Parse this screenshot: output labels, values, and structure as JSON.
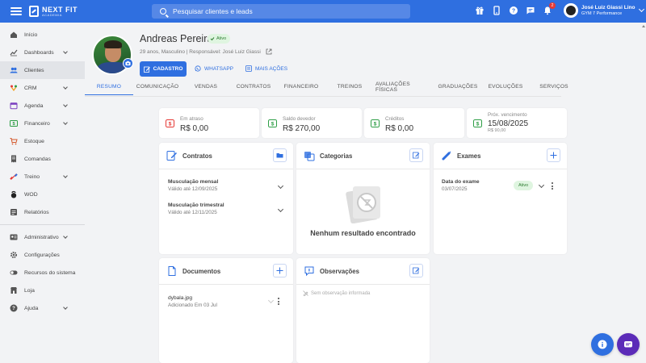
{
  "topbar": {
    "logo_line1": "NEXT FIT",
    "logo_line2": "ACADEMIA",
    "search_placeholder": "Pesquisar clientes e leads",
    "notification_count": "2",
    "user_name": "José Luiz Giassi Lino",
    "user_gym": "GYM 7 Performance",
    "icons": [
      "gift-icon",
      "tablet-icon",
      "help-icon",
      "chat-icon",
      "bell-icon"
    ]
  },
  "sidebar": {
    "items": [
      {
        "label": "Início",
        "icon": "home-icon",
        "chevron": false,
        "active": false
      },
      {
        "label": "Dashboards",
        "icon": "chart-icon",
        "chevron": true,
        "active": false
      },
      {
        "label": "Clientes",
        "icon": "users-icon",
        "chevron": false,
        "active": true
      },
      {
        "label": "CRM",
        "icon": "crm-icon",
        "chevron": true,
        "active": false
      },
      {
        "label": "Agenda",
        "icon": "calendar-icon",
        "chevron": true,
        "active": false
      },
      {
        "label": "Financeiro",
        "icon": "money-icon",
        "chevron": true,
        "active": false
      },
      {
        "label": "Estoque",
        "icon": "cart-icon",
        "chevron": false,
        "active": false
      },
      {
        "label": "Comandas",
        "icon": "receipt-icon",
        "chevron": false,
        "active": false
      },
      {
        "label": "Treino",
        "icon": "dumbbell-icon",
        "chevron": true,
        "active": false
      },
      {
        "label": "WOD",
        "icon": "kettlebell-icon",
        "chevron": false,
        "active": false
      },
      {
        "label": "Relatórios",
        "icon": "report-icon",
        "chevron": false,
        "active": false
      }
    ],
    "items2": [
      {
        "label": "Administrativo",
        "icon": "admin-icon",
        "chevron": true
      },
      {
        "label": "Configurações",
        "icon": "gear-icon",
        "chevron": false
      },
      {
        "label": "Recursos do sistema",
        "icon": "toggle-icon",
        "chevron": false
      },
      {
        "label": "Loja",
        "icon": "store-icon",
        "chevron": false
      },
      {
        "label": "Ajuda",
        "icon": "help-icon",
        "chevron": true
      }
    ]
  },
  "profile": {
    "name": "Andreas Pereira",
    "status": "Ativo",
    "info": "29 anos, Masculino | Responsável: José Luiz Giassi",
    "btn_cadastro": "CADASTRO",
    "btn_whatsapp": "WHATSAPP",
    "btn_more": "MAIS AÇÕES"
  },
  "tabs": [
    "RESUMO",
    "COMUNICAÇÃO",
    "VENDAS",
    "CONTRATOS",
    "FINANCEIRO",
    "TREINOS",
    "AVALIAÇÕES FÍSICAS",
    "GRADUAÇÕES",
    "EVOLUÇÕES",
    "SERVIÇOS"
  ],
  "summary": [
    {
      "label": "Em atraso",
      "value": "R$ 0,00",
      "sub": "",
      "color": "#e53935"
    },
    {
      "label": "Saldo devedor",
      "value": "R$ 270,00",
      "sub": "",
      "color": "#2e9e46"
    },
    {
      "label": "Créditos",
      "value": "R$ 0,00",
      "sub": "",
      "color": "#2e9e46"
    },
    {
      "label": "Próx. vencimento",
      "value": "15/08/2025",
      "sub": "R$ 90,00",
      "color": "#2e9e46"
    }
  ],
  "contratos": {
    "title": "Contratos",
    "items": [
      {
        "name": "Musculação mensal",
        "valid": "Válido até 12/09/2025"
      },
      {
        "name": "Musculação trimestral",
        "valid": "Válido até 12/11/2025"
      }
    ]
  },
  "categorias": {
    "title": "Categorias",
    "empty": "Nenhum resultado encontrado"
  },
  "exames": {
    "title": "Exames",
    "item_title": "Data do exame",
    "item_date": "03/07/2025",
    "item_status": "Ativo"
  },
  "documentos": {
    "title": "Documentos",
    "file_name": "dybala.jpg",
    "file_date": "Adicionado Em 03 Jul"
  },
  "observacoes": {
    "title": "Observações",
    "empty": "Sem observação informada"
  }
}
